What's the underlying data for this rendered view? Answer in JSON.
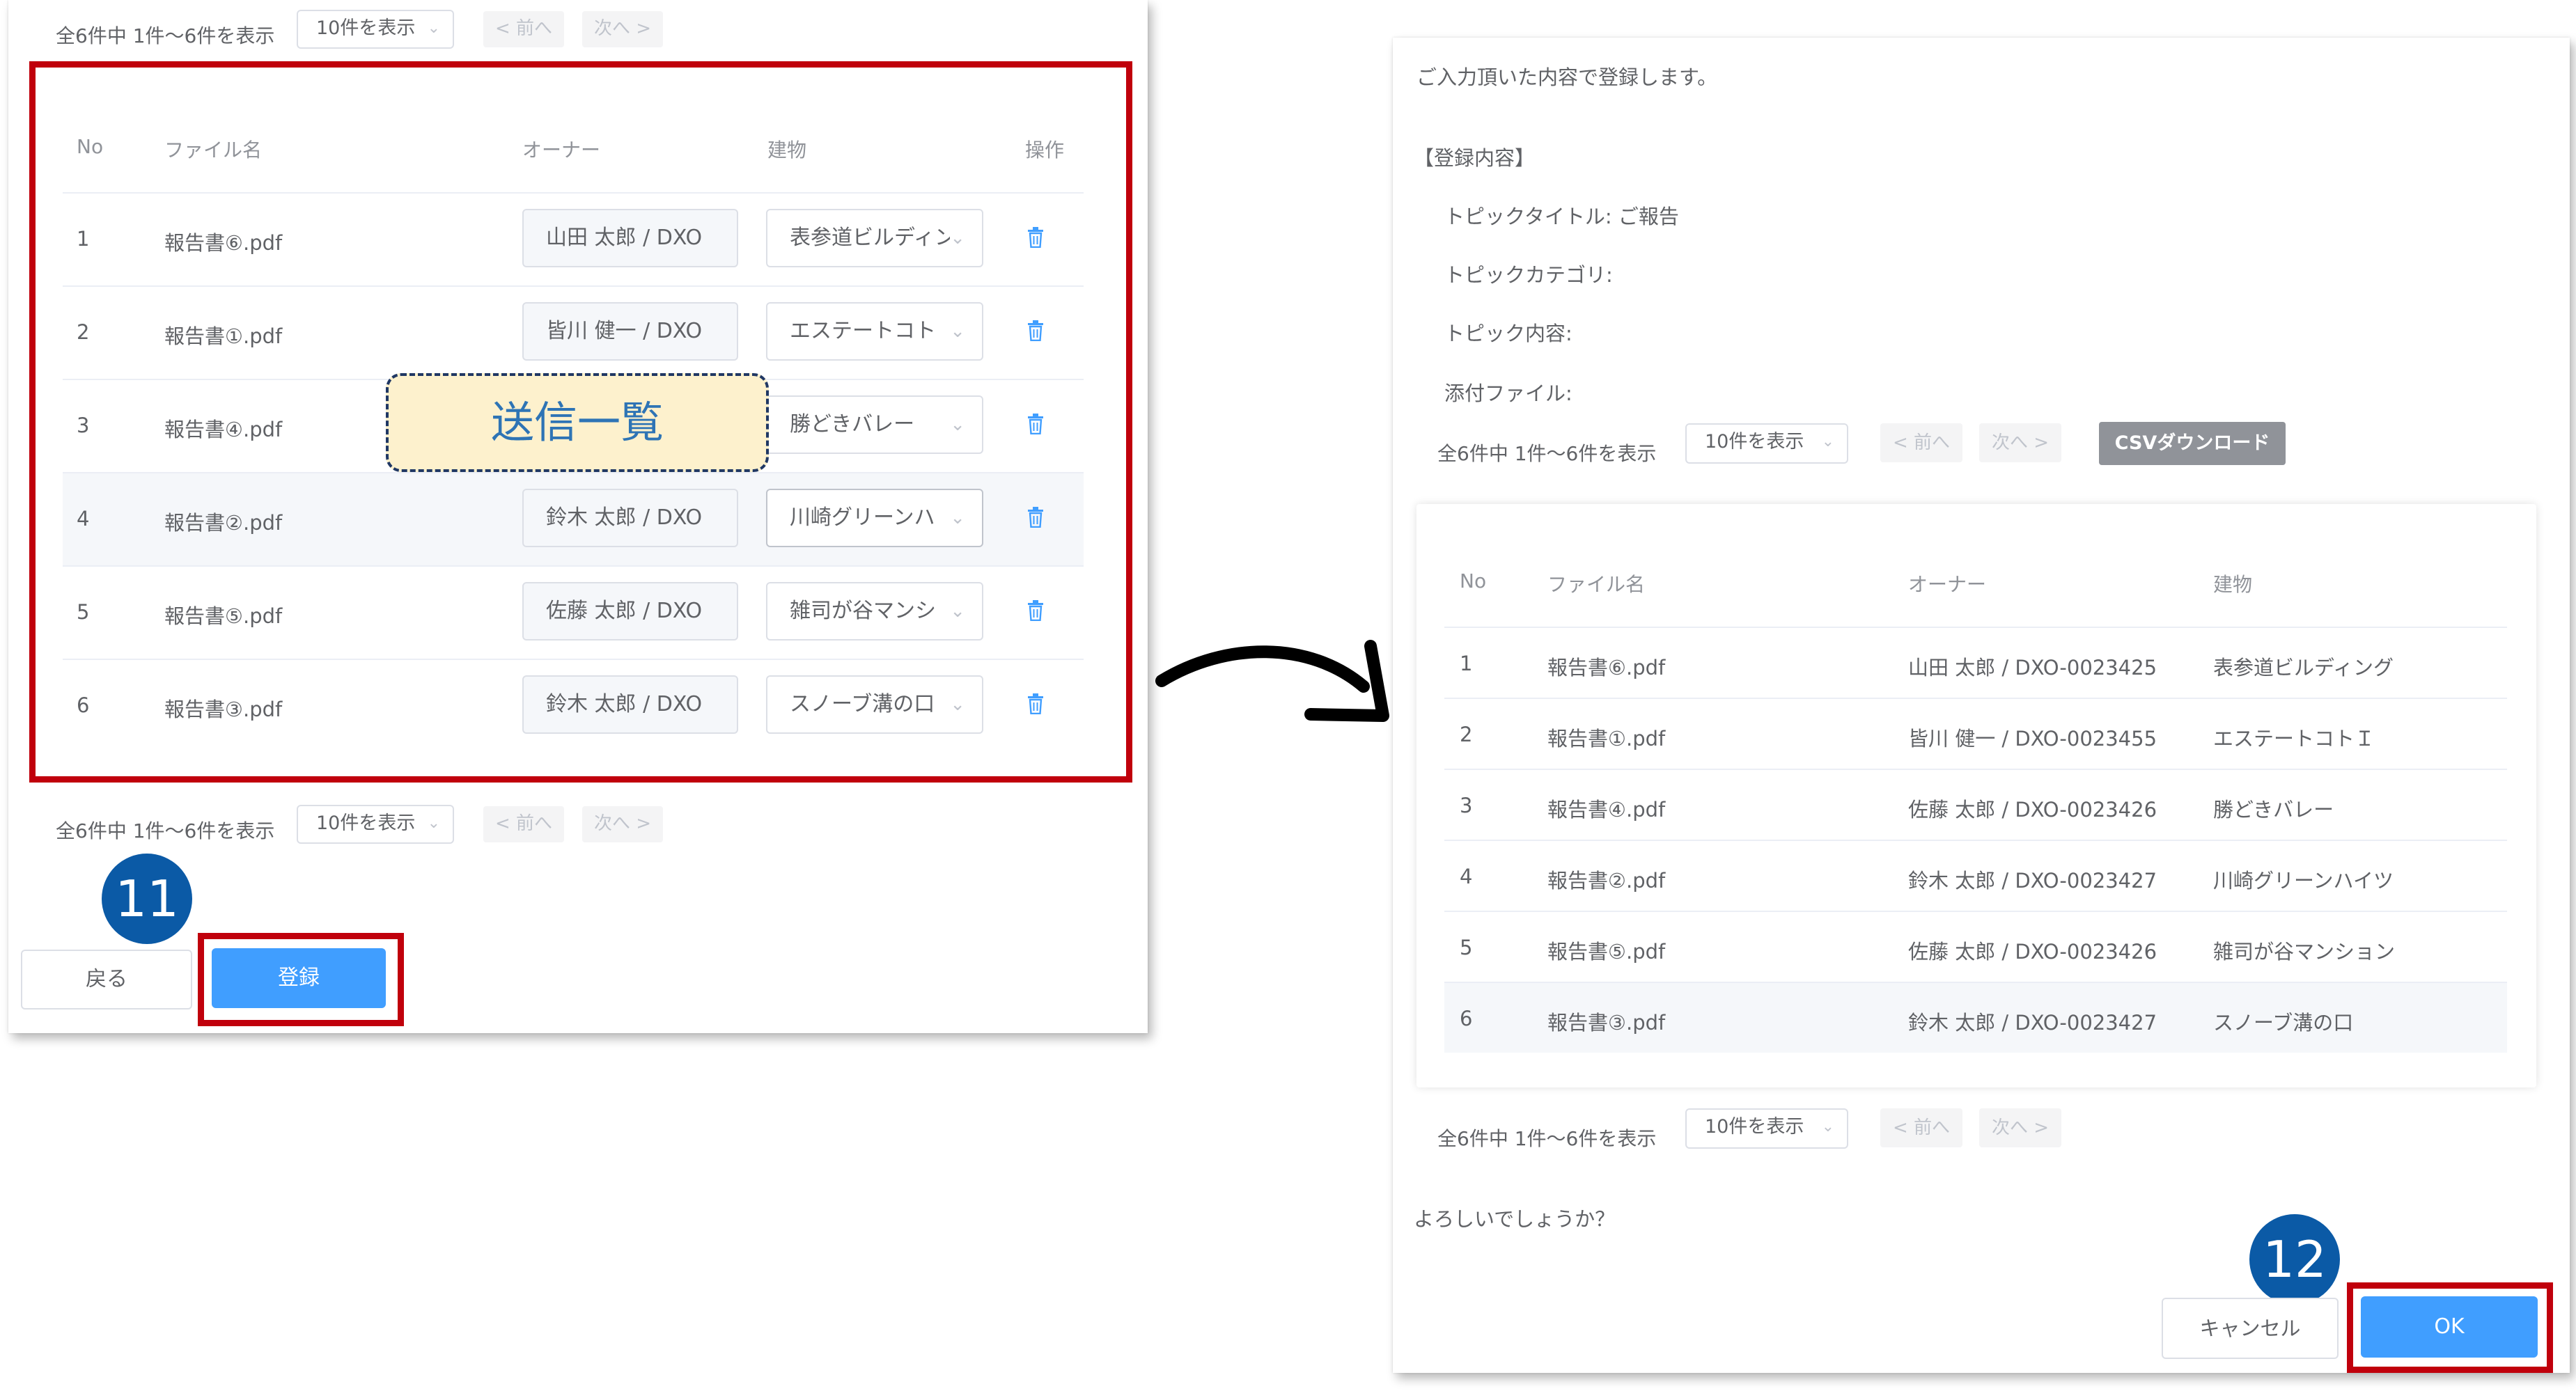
{
  "left": {
    "pager_top": {
      "summary": "全6件中 1件～6件を表示",
      "page_size": "10件を表示",
      "prev": "< 前へ",
      "next": "次へ >"
    },
    "table": {
      "headers": {
        "no": "No",
        "file": "ファイル名",
        "owner": "オーナー",
        "building": "建物",
        "action": "操作"
      },
      "rows": [
        {
          "no": "1",
          "file": "報告書⑥.pdf",
          "owner": "山田 太郎 / DXO",
          "building": "表参道ビルディン"
        },
        {
          "no": "2",
          "file": "報告書①.pdf",
          "owner": "皆川 健一 / DXO",
          "building": "エステートコト"
        },
        {
          "no": "3",
          "file": "報告書④.pdf",
          "owner": "",
          "building": "勝どきバレー"
        },
        {
          "no": "4",
          "file": "報告書②.pdf",
          "owner": "鈴木 太郎 / DXO",
          "building": "川崎グリーンハ"
        },
        {
          "no": "5",
          "file": "報告書⑤.pdf",
          "owner": "佐藤 太郎 / DXO",
          "building": "雑司が谷マンシ"
        },
        {
          "no": "6",
          "file": "報告書③.pdf",
          "owner": "鈴木 太郎 / DXO",
          "building": "スノーブ溝の口"
        }
      ]
    },
    "callout": "送信一覧",
    "pager_bottom": {
      "summary": "全6件中 1件～6件を表示",
      "page_size": "10件を表示",
      "prev": "< 前へ",
      "next": "次へ >"
    },
    "badge": "11",
    "back_label": "戻る",
    "register_label": "登録"
  },
  "right": {
    "intro": "ご入力頂いた内容で登録します。",
    "section_title": "【登録内容】",
    "fields": {
      "topic_title": "トピックタイトル: ご報告",
      "topic_category": "トピックカテゴリ:",
      "topic_content": "トピック内容:",
      "attachment": "添付ファイル:"
    },
    "pager_top": {
      "summary": "全6件中 1件～6件を表示",
      "page_size": "10件を表示",
      "prev": "< 前へ",
      "next": "次へ >"
    },
    "csv_label": "CSVダウンロード",
    "table": {
      "headers": {
        "no": "No",
        "file": "ファイル名",
        "owner": "オーナー",
        "building": "建物"
      },
      "rows": [
        {
          "no": "1",
          "file": "報告書⑥.pdf",
          "owner": "山田 太郎 / DXO-0023425",
          "building": "表参道ビルディング"
        },
        {
          "no": "2",
          "file": "報告書①.pdf",
          "owner": "皆川 健一 / DXO-0023455",
          "building": "エステートコトＩ"
        },
        {
          "no": "3",
          "file": "報告書④.pdf",
          "owner": "佐藤 太郎 / DXO-0023426",
          "building": "勝どきバレー"
        },
        {
          "no": "4",
          "file": "報告書②.pdf",
          "owner": "鈴木 太郎 / DXO-0023427",
          "building": "川崎グリーンハイツ"
        },
        {
          "no": "5",
          "file": "報告書⑤.pdf",
          "owner": "佐藤 太郎 / DXO-0023426",
          "building": "雑司が谷マンション"
        },
        {
          "no": "6",
          "file": "報告書③.pdf",
          "owner": "鈴木 太郎 / DXO-0023427",
          "building": "スノーブ溝の口"
        }
      ]
    },
    "pager_bottom": {
      "summary": "全6件中 1件～6件を表示",
      "page_size": "10件を表示",
      "prev": "< 前へ",
      "next": "次へ >"
    },
    "confirm_question": "よろしいでしょうか？",
    "badge": "12",
    "cancel_label": "キャンセル",
    "ok_label": "OK"
  },
  "icons": {
    "trash": "trash-icon",
    "chevron": "chevron-down-icon",
    "arrow": "curved-arrow-icon"
  },
  "colors": {
    "primary": "#409eff",
    "highlight_red": "#c0000c",
    "badge_blue": "#0b5aa6",
    "callout_bg": "#fdf1cd",
    "callout_border": "#203864",
    "csv_button": "#909399"
  }
}
